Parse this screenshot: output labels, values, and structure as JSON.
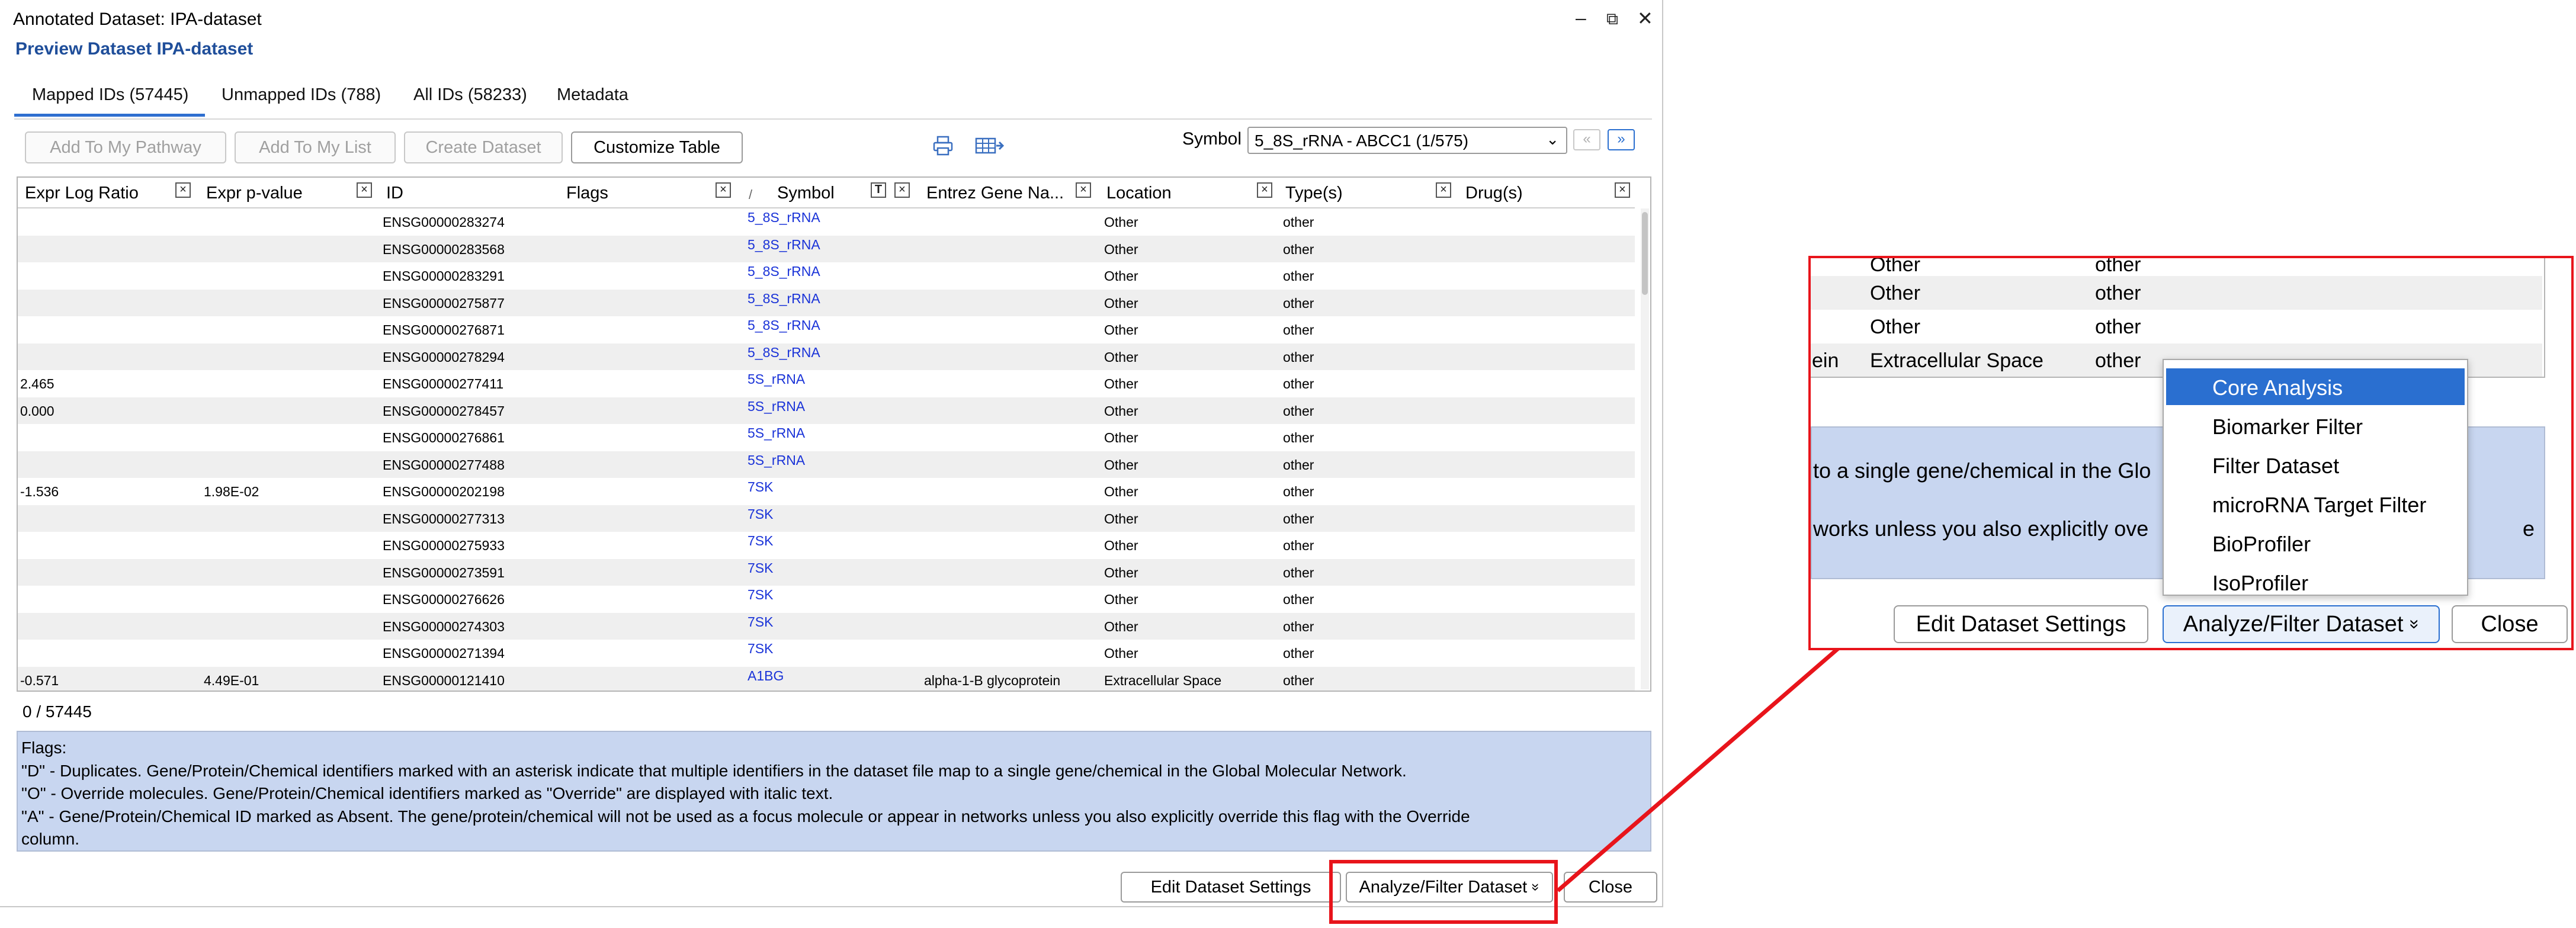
{
  "window": {
    "title": "Annotated Dataset: IPA-dataset",
    "subtitle": "Preview Dataset IPA-dataset",
    "controls": {
      "minimize": "–",
      "restore": "⧉",
      "close": "✕"
    }
  },
  "tabs": [
    {
      "label": "Mapped IDs (57445)",
      "active": true
    },
    {
      "label": "Unmapped IDs (788)",
      "active": false
    },
    {
      "label": "All IDs (58233)",
      "active": false
    },
    {
      "label": "Metadata",
      "active": false
    }
  ],
  "toolbar": {
    "add_pathway": "Add To My Pathway",
    "add_list": "Add To My List",
    "create_dataset": "Create Dataset",
    "customize_table": "Customize Table",
    "symbol_label": "Symbol",
    "symbol_value": "5_8S_rRNA - ABCC1 (1/575)",
    "prev_glyph": "«",
    "next_glyph": "»",
    "icons": {
      "print": "printer-icon",
      "export": "table-export-icon"
    }
  },
  "table": {
    "columns": [
      "Expr Log Ratio",
      "Expr p-value",
      "ID",
      "Flags",
      "Symbol",
      "Entrez Gene Na...",
      "Location",
      "Type(s)",
      "Drug(s)"
    ],
    "close_glyph": "×",
    "filter_glyph": "T",
    "sort_glyph": "/",
    "rows": [
      {
        "ratio": "",
        "pvalue": "",
        "id": "ENSG00000283274",
        "flags": "",
        "symbol": "5_8S_rRNA",
        "entrez": "",
        "location": "Other",
        "type": "other",
        "drug": ""
      },
      {
        "ratio": "",
        "pvalue": "",
        "id": "ENSG00000283568",
        "flags": "",
        "symbol": "5_8S_rRNA",
        "entrez": "",
        "location": "Other",
        "type": "other",
        "drug": ""
      },
      {
        "ratio": "",
        "pvalue": "",
        "id": "ENSG00000283291",
        "flags": "",
        "symbol": "5_8S_rRNA",
        "entrez": "",
        "location": "Other",
        "type": "other",
        "drug": ""
      },
      {
        "ratio": "",
        "pvalue": "",
        "id": "ENSG00000275877",
        "flags": "",
        "symbol": "5_8S_rRNA",
        "entrez": "",
        "location": "Other",
        "type": "other",
        "drug": ""
      },
      {
        "ratio": "",
        "pvalue": "",
        "id": "ENSG00000276871",
        "flags": "",
        "symbol": "5_8S_rRNA",
        "entrez": "",
        "location": "Other",
        "type": "other",
        "drug": ""
      },
      {
        "ratio": "",
        "pvalue": "",
        "id": "ENSG00000278294",
        "flags": "",
        "symbol": "5_8S_rRNA",
        "entrez": "",
        "location": "Other",
        "type": "other",
        "drug": ""
      },
      {
        "ratio": "2.465",
        "pvalue": "",
        "id": "ENSG00000277411",
        "flags": "",
        "symbol": "5S_rRNA",
        "entrez": "",
        "location": "Other",
        "type": "other",
        "drug": ""
      },
      {
        "ratio": "0.000",
        "pvalue": "",
        "id": "ENSG00000278457",
        "flags": "",
        "symbol": "5S_rRNA",
        "entrez": "",
        "location": "Other",
        "type": "other",
        "drug": ""
      },
      {
        "ratio": "",
        "pvalue": "",
        "id": "ENSG00000276861",
        "flags": "",
        "symbol": "5S_rRNA",
        "entrez": "",
        "location": "Other",
        "type": "other",
        "drug": ""
      },
      {
        "ratio": "",
        "pvalue": "",
        "id": "ENSG00000277488",
        "flags": "",
        "symbol": "5S_rRNA",
        "entrez": "",
        "location": "Other",
        "type": "other",
        "drug": ""
      },
      {
        "ratio": "-1.536",
        "pvalue": "1.98E-02",
        "id": "ENSG00000202198",
        "flags": "",
        "symbol": "7SK",
        "entrez": "",
        "location": "Other",
        "type": "other",
        "drug": ""
      },
      {
        "ratio": "",
        "pvalue": "",
        "id": "ENSG00000277313",
        "flags": "",
        "symbol": "7SK",
        "entrez": "",
        "location": "Other",
        "type": "other",
        "drug": ""
      },
      {
        "ratio": "",
        "pvalue": "",
        "id": "ENSG00000275933",
        "flags": "",
        "symbol": "7SK",
        "entrez": "",
        "location": "Other",
        "type": "other",
        "drug": ""
      },
      {
        "ratio": "",
        "pvalue": "",
        "id": "ENSG00000273591",
        "flags": "",
        "symbol": "7SK",
        "entrez": "",
        "location": "Other",
        "type": "other",
        "drug": ""
      },
      {
        "ratio": "",
        "pvalue": "",
        "id": "ENSG00000276626",
        "flags": "",
        "symbol": "7SK",
        "entrez": "",
        "location": "Other",
        "type": "other",
        "drug": ""
      },
      {
        "ratio": "",
        "pvalue": "",
        "id": "ENSG00000274303",
        "flags": "",
        "symbol": "7SK",
        "entrez": "",
        "location": "Other",
        "type": "other",
        "drug": ""
      },
      {
        "ratio": "",
        "pvalue": "",
        "id": "ENSG00000271394",
        "flags": "",
        "symbol": "7SK",
        "entrez": "",
        "location": "Other",
        "type": "other",
        "drug": ""
      },
      {
        "ratio": "-0.571",
        "pvalue": "4.49E-01",
        "id": "ENSG00000121410",
        "flags": "",
        "symbol": "A1BG",
        "entrez": "alpha-1-B glycoprotein",
        "location": "Extracellular Space",
        "type": "other",
        "drug": ""
      }
    ]
  },
  "selection_count": "0 / 57445",
  "flags_info": {
    "heading": "Flags:",
    "lines": [
      "\"D\" - Duplicates. Gene/Protein/Chemical identifiers marked with an asterisk indicate that multiple identifiers in the dataset file map to a single gene/chemical in the Global Molecular Network.",
      "\"O\" - Override molecules. Gene/Protein/Chemical identifiers marked as \"Override\" are displayed with italic text.",
      "\"A\" - Gene/Protein/Chemical ID marked as Absent. The gene/protein/chemical will not be used as a focus molecule or appear in networks unless you also explicitly override this flag with the Override",
      "column."
    ]
  },
  "footer": {
    "edit_settings": "Edit Dataset Settings",
    "analyze_filter": "Analyze/Filter Dataset",
    "analyze_glyph": "»",
    "close": "Close"
  },
  "inset": {
    "rows": [
      {
        "left": "",
        "location": "Other",
        "type": "other"
      },
      {
        "left": "",
        "location": "Other",
        "type": "other"
      },
      {
        "left": "",
        "location": "Other",
        "type": "other"
      },
      {
        "left": "ein",
        "location": "Extracellular Space",
        "type": "other"
      }
    ],
    "blue_line1": "to a single gene/chemical in the Glo",
    "blue_line2": "works unless you also explicitly ove",
    "blue_tail": "e",
    "menu": [
      "Core Analysis",
      "Biomarker Filter",
      "Filter Dataset",
      "microRNA Target Filter",
      "BioProfiler",
      "IsoProfiler"
    ],
    "menu_selected_index": 0,
    "edit_settings": "Edit Dataset Settings",
    "analyze_filter": "Analyze/Filter Dataset",
    "analyze_glyph": "»",
    "close": "Close"
  },
  "colors": {
    "accent": "#2a6fd0",
    "title_blue": "#1f4e9a",
    "symbol_link": "#1a33d8",
    "info_panel": "#c8d6f0",
    "annotation_red": "#e8141b"
  }
}
